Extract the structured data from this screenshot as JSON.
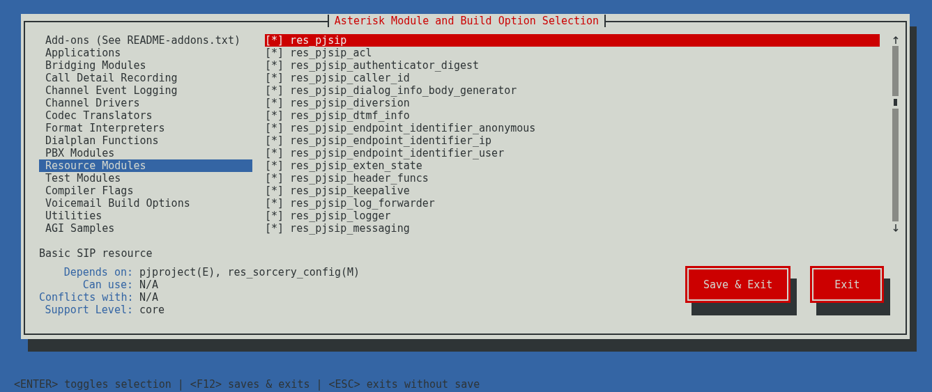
{
  "window": {
    "title": "Asterisk Module and Build Option Selection"
  },
  "categories": [
    {
      "label": "Add-ons (See README-addons.txt)",
      "selected": false
    },
    {
      "label": "Applications",
      "selected": false
    },
    {
      "label": "Bridging Modules",
      "selected": false
    },
    {
      "label": "Call Detail Recording",
      "selected": false
    },
    {
      "label": "Channel Event Logging",
      "selected": false
    },
    {
      "label": "Channel Drivers",
      "selected": false
    },
    {
      "label": "Codec Translators",
      "selected": false
    },
    {
      "label": "Format Interpreters",
      "selected": false
    },
    {
      "label": "Dialplan Functions",
      "selected": false
    },
    {
      "label": "PBX Modules",
      "selected": false
    },
    {
      "label": "Resource Modules",
      "selected": true
    },
    {
      "label": "Test Modules",
      "selected": false
    },
    {
      "label": "Compiler Flags",
      "selected": false
    },
    {
      "label": "Voicemail Build Options",
      "selected": false
    },
    {
      "label": "Utilities",
      "selected": false
    },
    {
      "label": "AGI Samples",
      "selected": false
    }
  ],
  "modules": [
    {
      "box": "[*]",
      "name": "res_pjsip",
      "selected": true
    },
    {
      "box": "[*]",
      "name": "res_pjsip_acl",
      "selected": false
    },
    {
      "box": "[*]",
      "name": "res_pjsip_authenticator_digest",
      "selected": false
    },
    {
      "box": "[*]",
      "name": "res_pjsip_caller_id",
      "selected": false
    },
    {
      "box": "[*]",
      "name": "res_pjsip_dialog_info_body_generator",
      "selected": false
    },
    {
      "box": "[*]",
      "name": "res_pjsip_diversion",
      "selected": false
    },
    {
      "box": "[*]",
      "name": "res_pjsip_dtmf_info",
      "selected": false
    },
    {
      "box": "[*]",
      "name": "res_pjsip_endpoint_identifier_anonymous",
      "selected": false
    },
    {
      "box": "[*]",
      "name": "res_pjsip_endpoint_identifier_ip",
      "selected": false
    },
    {
      "box": "[*]",
      "name": "res_pjsip_endpoint_identifier_user",
      "selected": false
    },
    {
      "box": "[*]",
      "name": "res_pjsip_exten_state",
      "selected": false
    },
    {
      "box": "[*]",
      "name": "res_pjsip_header_funcs",
      "selected": false
    },
    {
      "box": "[*]",
      "name": "res_pjsip_keepalive",
      "selected": false
    },
    {
      "box": "[*]",
      "name": "res_pjsip_log_forwarder",
      "selected": false
    },
    {
      "box": "[*]",
      "name": "res_pjsip_logger",
      "selected": false
    },
    {
      "box": "[*]",
      "name": "res_pjsip_messaging",
      "selected": false
    }
  ],
  "description": "Basic SIP resource",
  "details": [
    {
      "label": "Depends on:",
      "value": "pjproject(E), res_sorcery_config(M)"
    },
    {
      "label": "Can use:",
      "value": "N/A"
    },
    {
      "label": "Conflicts with:",
      "value": "N/A"
    },
    {
      "label": "Support Level:",
      "value": "core"
    }
  ],
  "buttons": [
    "Save & Exit",
    "Exit"
  ],
  "status_bar": "<ENTER> toggles selection | <F12> saves & exits | <ESC> exits without save"
}
